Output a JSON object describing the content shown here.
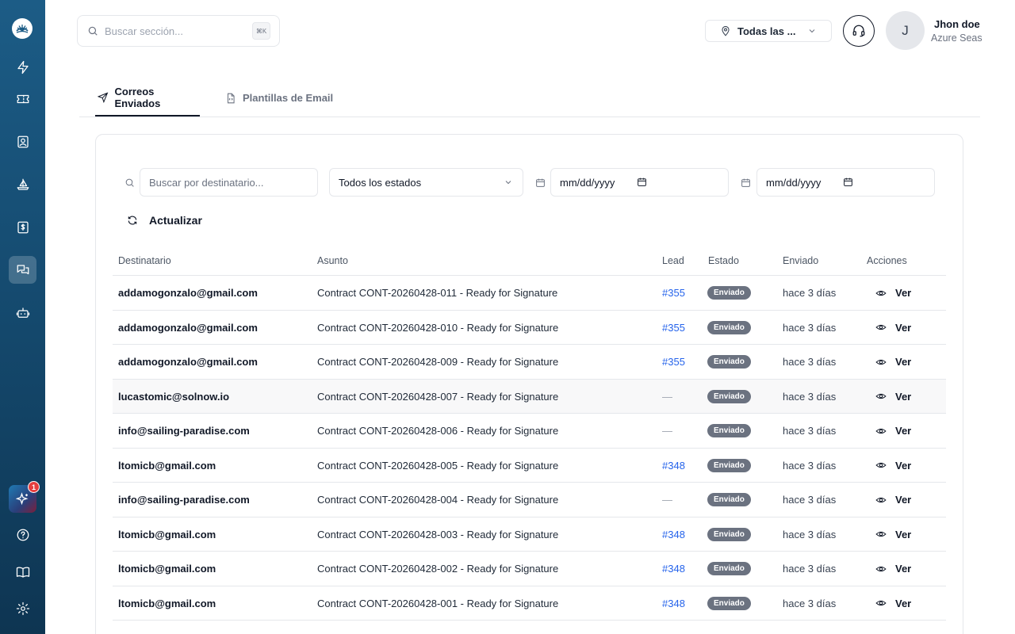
{
  "header": {
    "search_placeholder": "Buscar sección...",
    "search_shortcut": "⌘K",
    "location_select": "Todas las ...",
    "avatar_initial": "J",
    "user_name": "Jhon doe",
    "user_org": "Azure Seas"
  },
  "sidebar": {
    "items": [
      {
        "icon": "lightning-icon"
      },
      {
        "icon": "ticket-icon"
      },
      {
        "icon": "contact-icon"
      },
      {
        "icon": "boat-icon"
      },
      {
        "icon": "invoice-icon"
      },
      {
        "icon": "messages-icon",
        "active": true
      },
      {
        "icon": "bot-icon"
      }
    ],
    "ai_badge": "1",
    "bottom": [
      {
        "icon": "help-icon"
      },
      {
        "icon": "book-icon"
      },
      {
        "icon": "gear-icon"
      }
    ]
  },
  "tabs": [
    {
      "label": "Correos Enviados",
      "active": true
    },
    {
      "label": "Plantillas de Email",
      "active": false
    }
  ],
  "filters": {
    "recipient_placeholder": "Buscar por destinatario...",
    "status_select": "Todos los estados",
    "date_from": "mm/dd/yyyy",
    "date_to": "mm/dd/yyyy",
    "refresh_label": "Actualizar"
  },
  "table": {
    "columns": [
      "Destinatario",
      "Asunto",
      "Lead",
      "Estado",
      "Enviado",
      "Acciones"
    ],
    "rows": [
      {
        "dest": "addamogonzalo@gmail.com",
        "subject": "Contract CONT-20260428-011 - Ready for Signature",
        "lead": "#355",
        "status": "Enviado",
        "sent": "hace 3 días",
        "action": "Ver"
      },
      {
        "dest": "addamogonzalo@gmail.com",
        "subject": "Contract CONT-20260428-010 - Ready for Signature",
        "lead": "#355",
        "status": "Enviado",
        "sent": "hace 3 días",
        "action": "Ver"
      },
      {
        "dest": "addamogonzalo@gmail.com",
        "subject": "Contract CONT-20260428-009 - Ready for Signature",
        "lead": "#355",
        "status": "Enviado",
        "sent": "hace 3 días",
        "action": "Ver"
      },
      {
        "dest": "lucastomic@solnow.io",
        "subject": "Contract CONT-20260428-007 - Ready for Signature",
        "lead": "—",
        "status": "Enviado",
        "sent": "hace 3 días",
        "action": "Ver"
      },
      {
        "dest": "info@sailing-paradise.com",
        "subject": "Contract CONT-20260428-006 - Ready for Signature",
        "lead": "—",
        "status": "Enviado",
        "sent": "hace 3 días",
        "action": "Ver"
      },
      {
        "dest": "ltomicb@gmail.com",
        "subject": "Contract CONT-20260428-005 - Ready for Signature",
        "lead": "#348",
        "status": "Enviado",
        "sent": "hace 3 días",
        "action": "Ver"
      },
      {
        "dest": "info@sailing-paradise.com",
        "subject": "Contract CONT-20260428-004 - Ready for Signature",
        "lead": "—",
        "status": "Enviado",
        "sent": "hace 3 días",
        "action": "Ver"
      },
      {
        "dest": "ltomicb@gmail.com",
        "subject": "Contract CONT-20260428-003 - Ready for Signature",
        "lead": "#348",
        "status": "Enviado",
        "sent": "hace 3 días",
        "action": "Ver"
      },
      {
        "dest": "ltomicb@gmail.com",
        "subject": "Contract CONT-20260428-002 - Ready for Signature",
        "lead": "#348",
        "status": "Enviado",
        "sent": "hace 3 días",
        "action": "Ver"
      },
      {
        "dest": "ltomicb@gmail.com",
        "subject": "Contract CONT-20260428-001 - Ready for Signature",
        "lead": "#348",
        "status": "Enviado",
        "sent": "hace 3 días",
        "action": "Ver"
      }
    ]
  },
  "colors": {
    "sidebar_top": "#1c5c86",
    "sidebar_bottom": "#0e3552",
    "link": "#2563eb",
    "status_badge": "#6b7280"
  }
}
